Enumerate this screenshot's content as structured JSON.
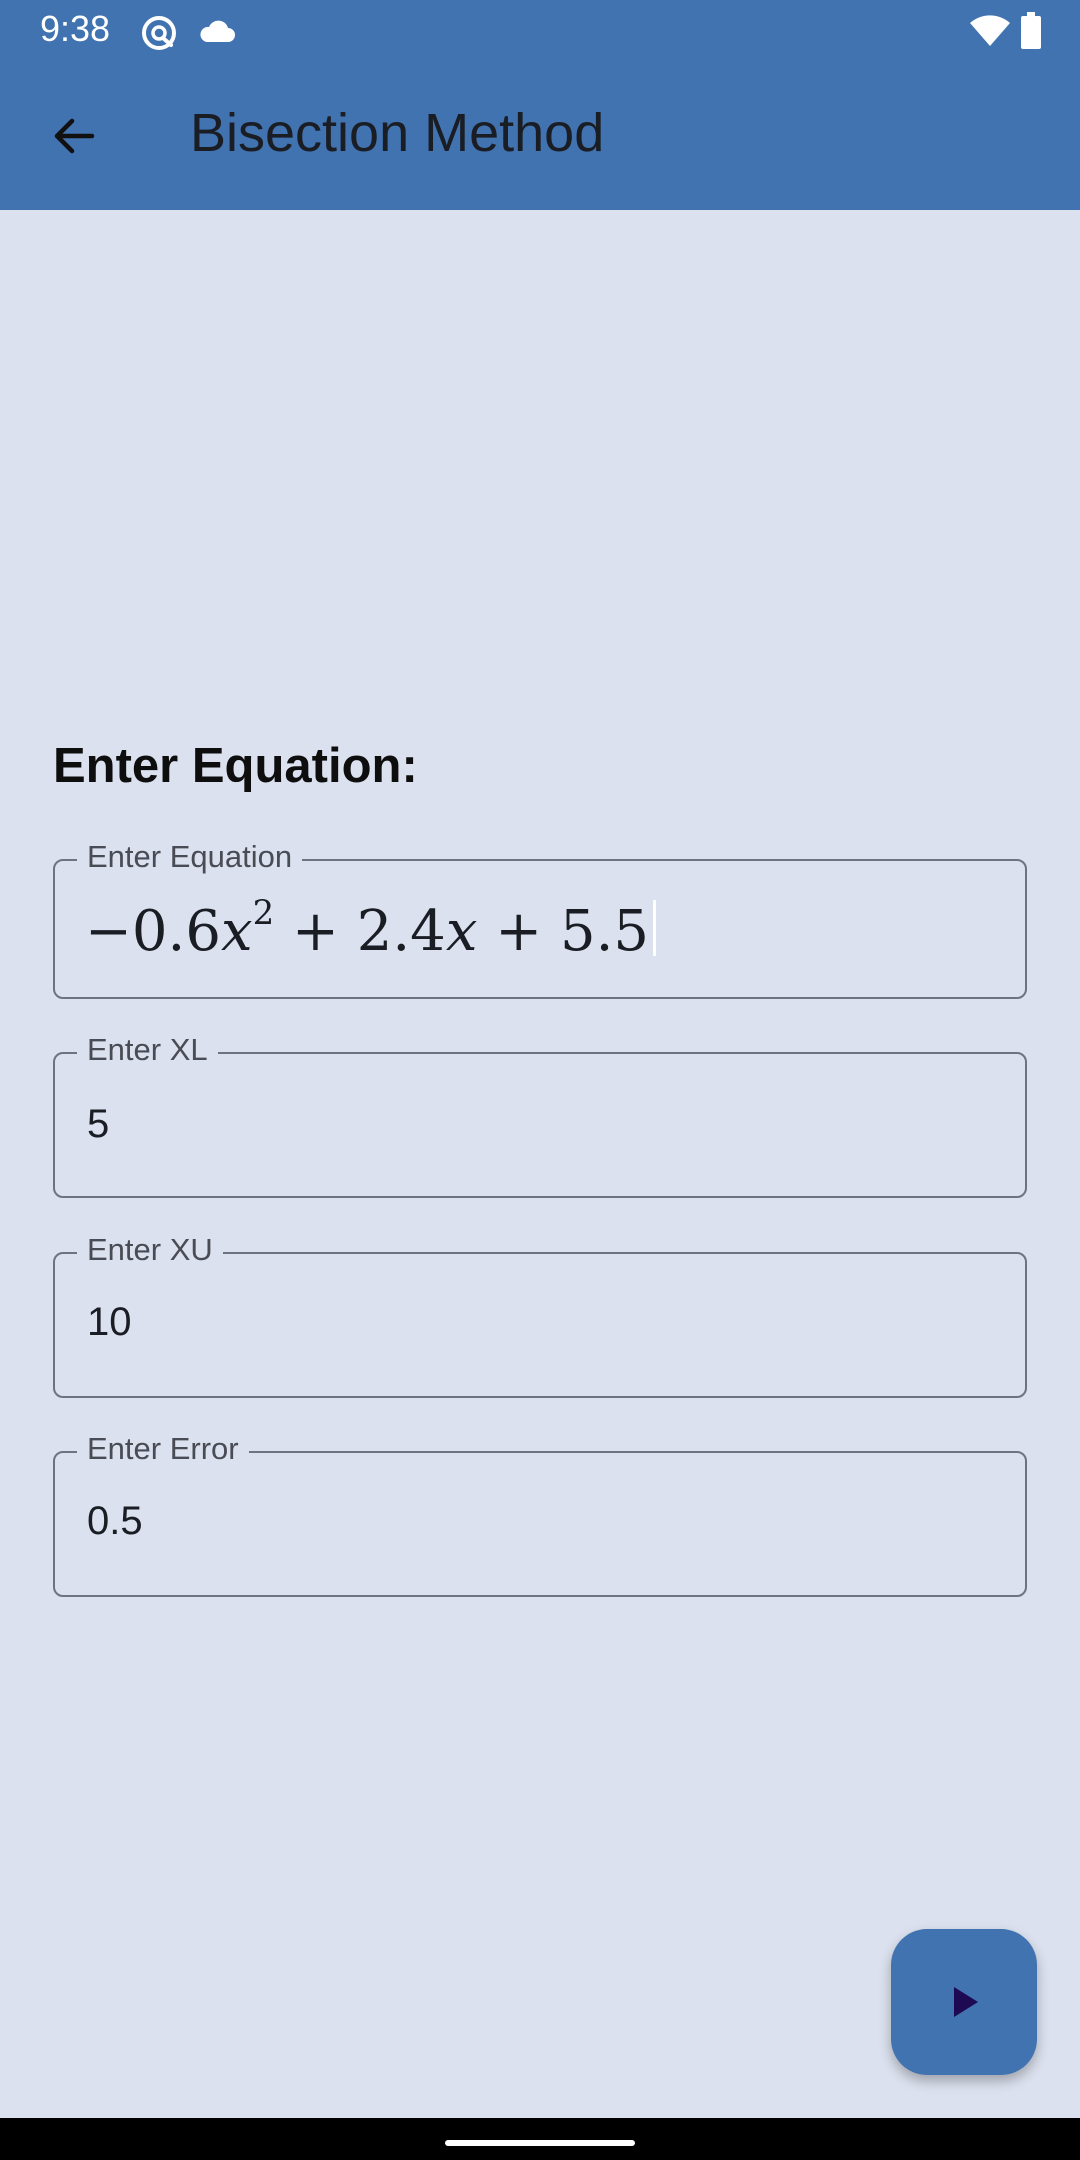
{
  "status_bar": {
    "time": "9:38",
    "icons_left": [
      "at-sign-icon",
      "cloud-icon"
    ],
    "icons_right": [
      "wifi-icon",
      "battery-icon"
    ]
  },
  "app_bar": {
    "back_icon": "arrow-left-icon",
    "title": "Bisection Method",
    "background_color": "#4173b0"
  },
  "form": {
    "heading": "Enter Equation:",
    "equation": {
      "label": "Enter Equation",
      "value": "−0.6x² + 2.4x + 5.5",
      "parts": {
        "coef_a": "−0.6",
        "var_1": "x",
        "exponent": "2",
        "op_1": " + ",
        "coef_b": "2.4",
        "var_2": "x",
        "op_2": " + ",
        "constant": "5.5"
      }
    },
    "xl": {
      "label": "Enter XL",
      "value": "5"
    },
    "xu": {
      "label": "Enter XU",
      "value": "10"
    },
    "error": {
      "label": "Enter Error",
      "value": "0.5"
    }
  },
  "fab": {
    "icon": "play-icon",
    "icon_color": "#1d0a52"
  },
  "colors": {
    "background": "#dbe1ee",
    "accent": "#4173b0",
    "outline": "#6f7380"
  }
}
